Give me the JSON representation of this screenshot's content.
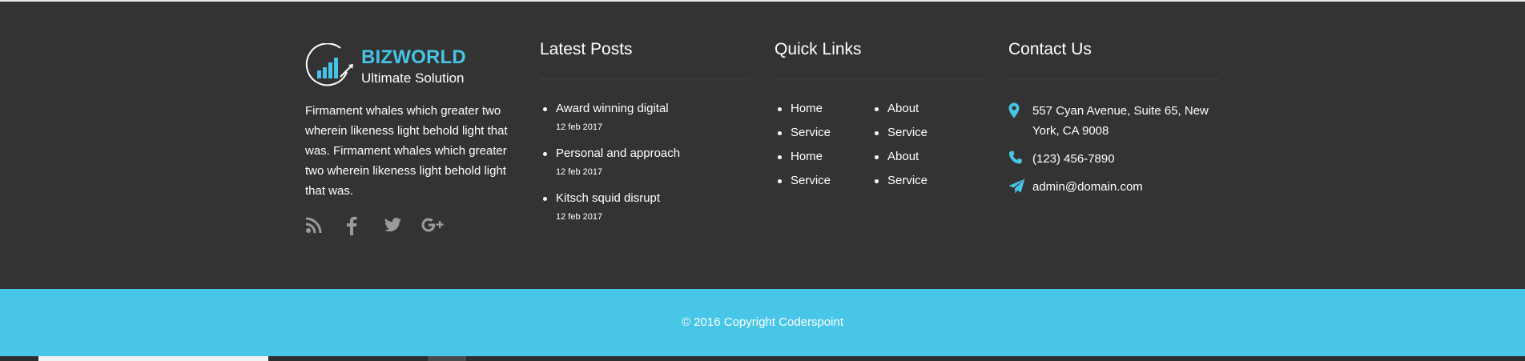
{
  "colors": {
    "background": "#333333",
    "accent": "#48c6e7",
    "brand": "#46c3e6",
    "text": "#ffffff",
    "icon_muted": "#9a9a9a"
  },
  "brand": {
    "name": "BIZWORLD",
    "tagline": "Ultimate Solution"
  },
  "about": {
    "text": "Firmament whales which greater two wherein likeness light behold light that was. Firmament whales which greater two wherein likeness light behold light that was.",
    "social_icons": [
      "rss-icon",
      "facebook-icon",
      "twitter-icon",
      "google-plus-icon"
    ]
  },
  "latest_posts": {
    "title": "Latest Posts",
    "items": [
      {
        "title": "Award winning digital",
        "date": "12 feb 2017"
      },
      {
        "title": "Personal and approach",
        "date": "12 feb 2017"
      },
      {
        "title": "Kitsch squid disrupt",
        "date": "12 feb 2017"
      }
    ]
  },
  "quick_links": {
    "title": "Quick Links",
    "col1": [
      "Home",
      "Service",
      "Home",
      "Service"
    ],
    "col2": [
      "About",
      "Service",
      "About",
      "Service"
    ]
  },
  "contact": {
    "title": "Contact Us",
    "address": "557 Cyan Avenue, Suite 65, New York, CA 9008",
    "phone": "(123) 456-7890",
    "email": "admin@domain.com",
    "icons": [
      "map-pin-icon",
      "phone-icon",
      "paper-plane-icon"
    ]
  },
  "footer": {
    "copyright": "© 2016 Copyright Coderspoint"
  }
}
